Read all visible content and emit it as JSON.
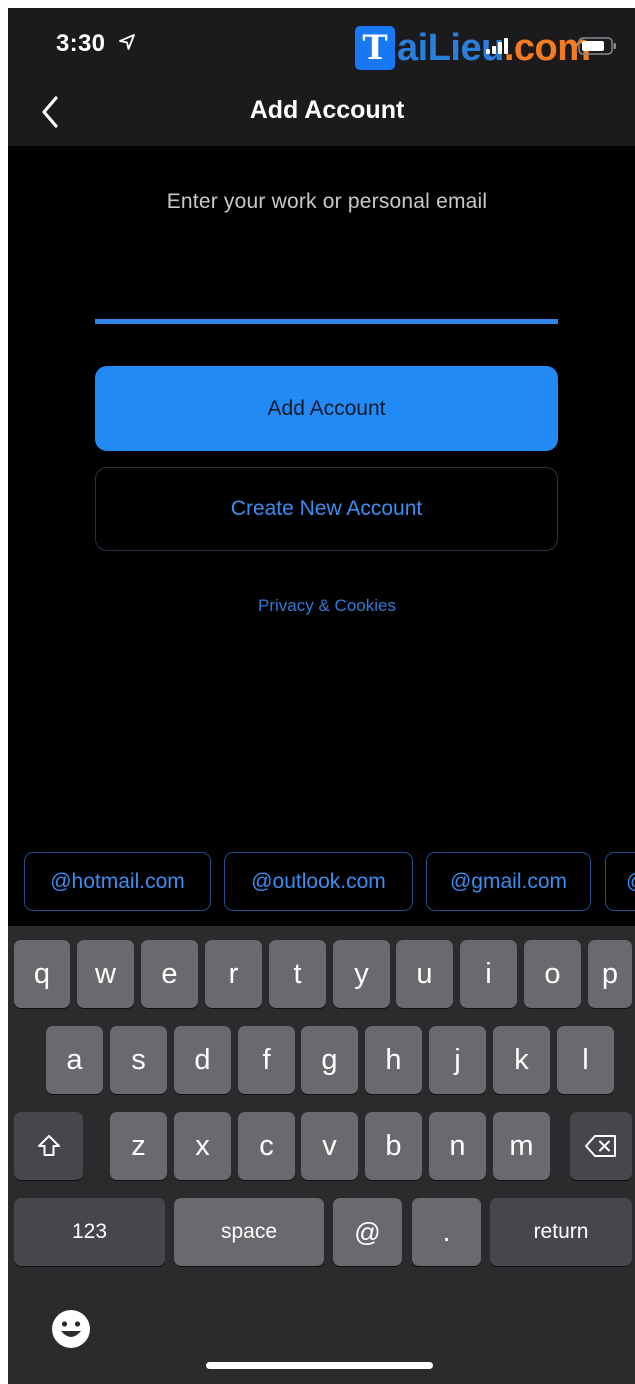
{
  "status_bar": {
    "time": "3:30",
    "watermark": {
      "box_letter": "T",
      "text_a": "aiLieu",
      "text_b": ".com"
    }
  },
  "nav": {
    "title": "Add Account"
  },
  "form": {
    "prompt": "Enter your work or personal email",
    "email_value": "",
    "add_account_label": "Add Account",
    "create_account_label": "Create New Account",
    "privacy_label": "Privacy & Cookies"
  },
  "suggestions": [
    "@hotmail.com",
    "@outlook.com",
    "@gmail.com",
    "@"
  ],
  "keyboard": {
    "row1": [
      "q",
      "w",
      "e",
      "r",
      "t",
      "y",
      "u",
      "i",
      "o",
      "p"
    ],
    "row2": [
      "a",
      "s",
      "d",
      "f",
      "g",
      "h",
      "j",
      "k",
      "l"
    ],
    "row3": [
      "z",
      "x",
      "c",
      "v",
      "b",
      "n",
      "m"
    ],
    "numbers_label": "123",
    "space_label": "space",
    "at_label": "@",
    "dot_label": ".",
    "return_label": "return"
  },
  "icons": {
    "location": "location-arrow-icon",
    "signal": "signal-icon",
    "battery": "battery-icon",
    "back": "chevron-left-icon",
    "shift": "shift-icon",
    "delete": "delete-icon",
    "emoji": "emoji-icon"
  },
  "colors": {
    "accent": "#2389f4",
    "link": "#3a8ef0",
    "background": "#000000",
    "bar": "#1b1b1d",
    "keyboard": "#2b2b2e",
    "key": "#6a6a6e",
    "function_key": "#47474b"
  }
}
